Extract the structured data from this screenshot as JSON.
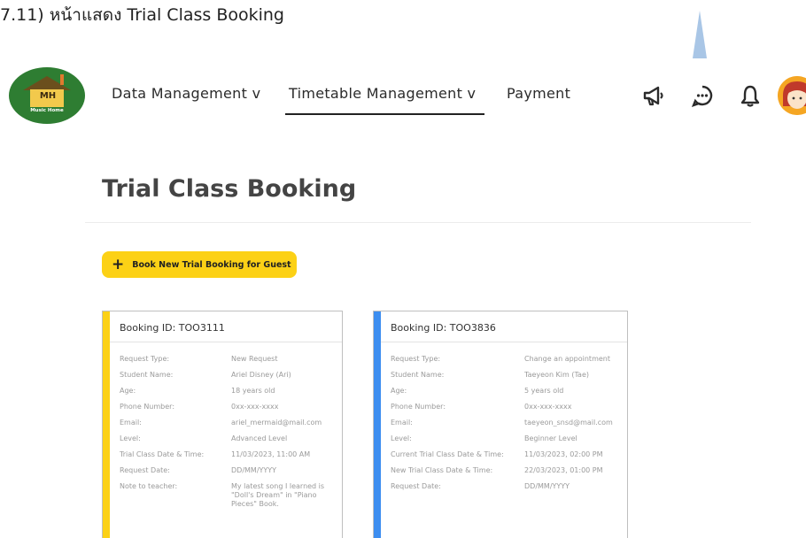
{
  "caption": "7.11) หน้าแสดง Trial Class Booking",
  "logo": {
    "initials": "MH",
    "subtitle": "Music Home"
  },
  "nav": {
    "items": [
      {
        "label": "Data Management v",
        "active": false
      },
      {
        "label": "Timetable Management v",
        "active": true
      },
      {
        "label": "Payment",
        "active": false
      }
    ]
  },
  "header_icons": [
    "megaphone-icon",
    "chat-icon",
    "bell-icon"
  ],
  "page": {
    "title": "Trial Class Booking"
  },
  "book_button": {
    "label": "Book New Trial Booking for Guest",
    "icon": "plus-icon",
    "color": "#fcd116"
  },
  "cards": [
    {
      "title": "Booking ID: TOO3111",
      "accent_color": "#fcd116",
      "rows": [
        {
          "label": "Request Type:",
          "value": "New Request"
        },
        {
          "label": "Student Name:",
          "value": "Ariel Disney (Ari)"
        },
        {
          "label": "Age:",
          "value": "18 years old"
        },
        {
          "label": "Phone Number:",
          "value": "0xx-xxx-xxxx"
        },
        {
          "label": "Email:",
          "value": "ariel_mermaid@mail.com"
        },
        {
          "label": "Level:",
          "value": "Advanced Level"
        },
        {
          "label": "Trial Class Date & Time:",
          "value": "11/03/2023, 11:00 AM"
        },
        {
          "label": "Request Date:",
          "value": "DD/MM/YYYY"
        },
        {
          "label": "Note to teacher:",
          "value": "My latest song I learned is \"Doll's Dream\" in \"Piano Pieces\" Book."
        }
      ]
    },
    {
      "title": "Booking ID: TOO3836",
      "accent_color": "#3d8ef0",
      "rows": [
        {
          "label": "Request Type:",
          "value": "Change an appointment"
        },
        {
          "label": "Student Name:",
          "value": "Taeyeon Kim (Tae)"
        },
        {
          "label": "Age:",
          "value": "5 years old"
        },
        {
          "label": "Phone Number:",
          "value": "0xx-xxx-xxxx"
        },
        {
          "label": "Email:",
          "value": "taeyeon_snsd@mail.com"
        },
        {
          "label": "Level:",
          "value": "Beginner Level"
        },
        {
          "label": "Current Trial Class Date & Time:",
          "value": "11/03/2023, 02:00 PM"
        },
        {
          "label": "New Trial Class Date & Time:",
          "value": "22/03/2023, 01:00 PM"
        },
        {
          "label": "Request Date:",
          "value": "DD/MM/YYYY"
        }
      ]
    }
  ]
}
